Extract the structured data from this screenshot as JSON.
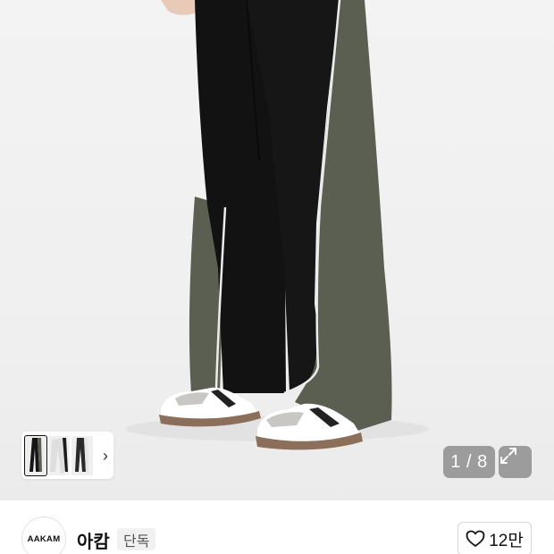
{
  "gallery": {
    "counter": "1 / 8",
    "thumbnails": [
      {
        "name": "black-pants",
        "selected": true
      },
      {
        "name": "white-pants",
        "selected": false
      },
      {
        "name": "grey-pants",
        "selected": false
      }
    ],
    "next_icon": "chevron-right-icon",
    "expand_icon": "expand-arrows-icon"
  },
  "brand": {
    "logo_text": "AAKAM",
    "name": "아캄",
    "badge": "단독"
  },
  "like": {
    "icon": "heart-outline-icon",
    "count": "12만"
  },
  "colors": {
    "background": "#efefef",
    "pants_black": "#121212",
    "pants_olive": "#5b5f51",
    "piping": "#e8e8e8",
    "overlay": "#828282"
  }
}
